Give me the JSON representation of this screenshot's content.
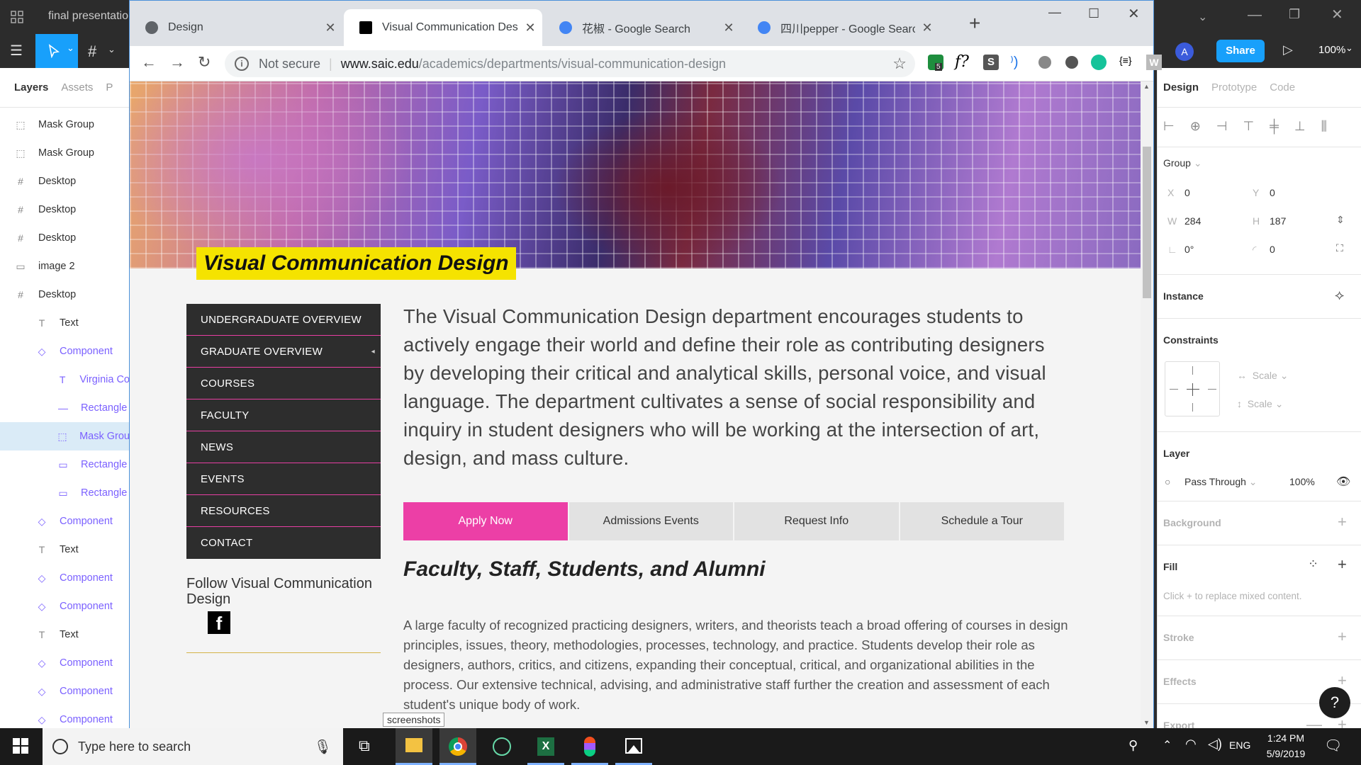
{
  "figma": {
    "file_title": "final presentation",
    "zoom": "100%",
    "share_label": "Share",
    "avatar_initial": "A",
    "left_tabs": [
      "Layers",
      "Assets",
      "P"
    ],
    "layers": [
      {
        "icon": "mask-icon",
        "label": "Mask Group",
        "indent": 0,
        "type": "normal"
      },
      {
        "icon": "mask-icon",
        "label": "Mask Group",
        "indent": 0,
        "type": "normal"
      },
      {
        "icon": "frame-icon",
        "label": "Desktop",
        "indent": 0,
        "type": "normal"
      },
      {
        "icon": "frame-icon",
        "label": "Desktop",
        "indent": 0,
        "type": "normal"
      },
      {
        "icon": "frame-icon",
        "label": "Desktop",
        "indent": 0,
        "type": "normal"
      },
      {
        "icon": "image-icon",
        "label": "image 2",
        "indent": 0,
        "type": "normal"
      },
      {
        "icon": "frame-icon",
        "label": "Desktop",
        "indent": 0,
        "type": "normal"
      },
      {
        "icon": "text-icon",
        "label": "Text",
        "indent": 1,
        "type": "normal"
      },
      {
        "icon": "component-icon",
        "label": "Component",
        "indent": 1,
        "type": "comp"
      },
      {
        "icon": "text-icon",
        "label": "Virginia Co",
        "indent": 2,
        "type": "comp"
      },
      {
        "icon": "line-icon",
        "label": "Rectangle",
        "indent": 2,
        "type": "comp"
      },
      {
        "icon": "mask-icon",
        "label": "Mask Grou",
        "indent": 2,
        "type": "comp-sel"
      },
      {
        "icon": "rect-icon",
        "label": "Rectangle",
        "indent": 2,
        "type": "comp"
      },
      {
        "icon": "rect-icon",
        "label": "Rectangle",
        "indent": 2,
        "type": "comp"
      },
      {
        "icon": "component-icon",
        "label": "Component",
        "indent": 1,
        "type": "comp"
      },
      {
        "icon": "text-icon",
        "label": "Text",
        "indent": 1,
        "type": "normal"
      },
      {
        "icon": "component-icon",
        "label": "Component",
        "indent": 1,
        "type": "comp"
      },
      {
        "icon": "component-icon",
        "label": "Component",
        "indent": 1,
        "type": "comp"
      },
      {
        "icon": "text-icon",
        "label": "Text",
        "indent": 1,
        "type": "normal"
      },
      {
        "icon": "component-icon",
        "label": "Component",
        "indent": 1,
        "type": "comp"
      },
      {
        "icon": "component-icon",
        "label": "Component",
        "indent": 1,
        "type": "comp"
      },
      {
        "icon": "component-icon",
        "label": "Component",
        "indent": 1,
        "type": "comp"
      }
    ],
    "right_tabs": [
      "Design",
      "Prototype",
      "Code"
    ],
    "group_label": "Group",
    "x_label": "X",
    "x_value": "0",
    "y_label": "Y",
    "y_value": "0",
    "w_label": "W",
    "w_value": "284",
    "h_label": "H",
    "h_value": "187",
    "rotation_value": "0°",
    "radius_value": "0",
    "instance_label": "Instance",
    "constraints_label": "Constraints",
    "constraint_h": "Scale",
    "constraint_v": "Scale",
    "layer_label": "Layer",
    "blend_mode": "Pass Through",
    "opacity": "100%",
    "background_label": "Background",
    "fill_label": "Fill",
    "fill_hint": "Click + to replace mixed content.",
    "stroke_label": "Stroke",
    "effects_label": "Effects",
    "export_label": "Export",
    "help_label": "?"
  },
  "browser": {
    "tabs": [
      {
        "title": "Design",
        "favicon_color": "#5f6368",
        "active": false
      },
      {
        "title": "Visual Communication Design |",
        "favicon_color": "#000000",
        "active": true
      },
      {
        "title": "花椒 - Google Search",
        "favicon_color": "#4285f4",
        "active": false
      },
      {
        "title": "四川pepper - Google Search",
        "favicon_color": "#4285f4",
        "active": false
      }
    ],
    "new_tab": "+",
    "security": "Not secure",
    "url_domain": "www.saic.edu",
    "url_path": "/academics/departments/visual-communication-design",
    "extension_badge": "5"
  },
  "page": {
    "title": "Visual Communication Design",
    "nav": [
      {
        "label": "UNDERGRADUATE OVERVIEW",
        "caret": ""
      },
      {
        "label": "GRADUATE OVERVIEW",
        "caret": "◂"
      },
      {
        "label": "COURSES",
        "caret": ""
      },
      {
        "label": "FACULTY",
        "caret": ""
      },
      {
        "label": "NEWS",
        "caret": ""
      },
      {
        "label": "EVENTS",
        "caret": ""
      },
      {
        "label": "RESOURCES",
        "caret": ""
      },
      {
        "label": "CONTACT",
        "caret": ""
      }
    ],
    "follow_text": "Follow Visual Communication Design",
    "facebook_glyph": "f",
    "intro": "The Visual Communication Design department encourages students to actively engage their world and define their role as contributing designers by developing their critical and analytical skills, personal voice, and visual language. The department cultivates a sense of social responsibility and inquiry in student designers who will be working at the intersection of art, design, and mass culture.",
    "cta": [
      "Apply Now",
      "Admissions Events",
      "Request Info",
      "Schedule a Tour"
    ],
    "section_heading": "Faculty, Staff, Students, and Alumni",
    "paragraph": "A large faculty of recognized practicing designers, writers, and theorists teach a broad offering of courses in design principles, issues, theory, methodologies, processes, technology, and practice. Students develop their role as designers, authors, critics, and citizens, expanding their conceptual, critical, and organizational abilities in the process. Our extensive technical, advising, and administrative staff further the creation and assessment of each student's unique body of work."
  },
  "taskbar": {
    "search_placeholder": "Type here to search",
    "tooltip": "screenshots",
    "language": "ENG",
    "time": "1:24 PM",
    "date": "5/9/2019"
  }
}
